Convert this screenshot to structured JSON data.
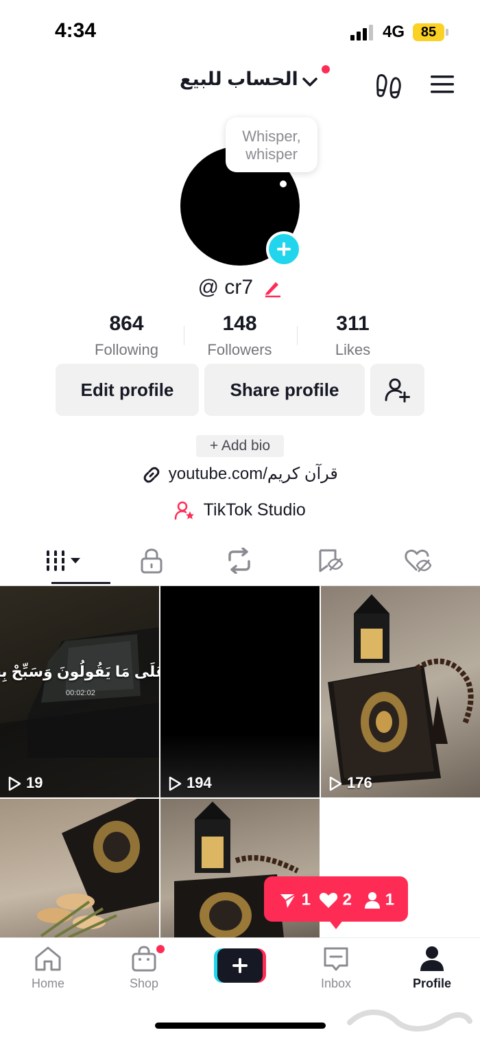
{
  "status_bar": {
    "time": "4:34",
    "network": "4G",
    "battery": "85"
  },
  "header": {
    "account_name": "الحساب للبيع"
  },
  "profile": {
    "whisper_bubble": "Whisper,\nwhisper",
    "username": "@ cr7"
  },
  "stats": [
    {
      "value": "864",
      "label": "Following"
    },
    {
      "value": "148",
      "label": "Followers"
    },
    {
      "value": "311",
      "label": "Likes"
    }
  ],
  "buttons": {
    "edit_profile": "Edit profile",
    "share_profile": "Share profile"
  },
  "bio": {
    "add_bio": "+ Add bio",
    "link": "youtube.com/قرآن كريم",
    "studio": "TikTok Studio"
  },
  "videos": [
    {
      "views": "19",
      "overlay_text": "عَلَى مَا يَقُولُونَ وَسَبِّحْ بِحَمْ",
      "timestamp": "00:02:02"
    },
    {
      "views": "194"
    },
    {
      "views": "176"
    }
  ],
  "notification": {
    "shares": "1",
    "likes": "2",
    "followers": "1"
  },
  "bottom_nav": {
    "home": "Home",
    "shop": "Shop",
    "inbox": "Inbox",
    "profile": "Profile"
  },
  "colors": {
    "accent": "#fe2c55",
    "cyan": "#20d5ec",
    "battery": "#fbd126"
  }
}
